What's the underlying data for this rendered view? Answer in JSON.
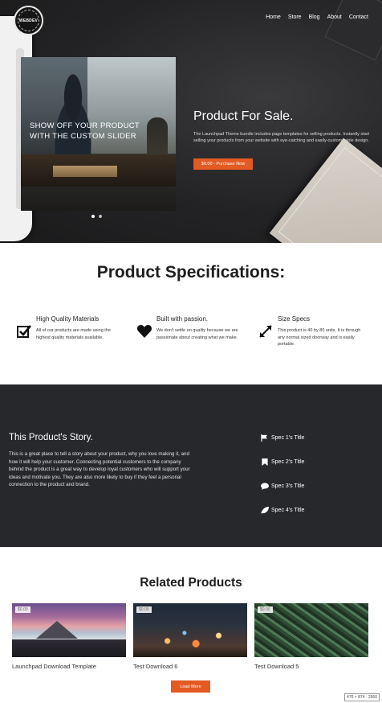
{
  "colors": {
    "accent": "#e35a22",
    "hero_bg": "#232325",
    "story_bg": "#26282c"
  },
  "header": {
    "logo_text": "WEBDEV",
    "nav": [
      "Home",
      "Store",
      "Blog",
      "About",
      "Contact"
    ]
  },
  "hero": {
    "caption": "SHOW OFF YOUR PRODUCT WITH THE CUSTOM SLIDER",
    "title": "Product For Sale.",
    "description": "The Launchpad Theme bundle includes page templates for selling products. Instantly start selling your products from your website with eye-catching and easily-customizable design.",
    "buy_button": "$0.00 - Purchase Now",
    "slides": 2
  },
  "specs": {
    "title": "Product Specifications:",
    "items": [
      {
        "icon": "checkbox-icon",
        "title": "High Quality Materials",
        "text": "All of our products are made using the highest quality materials available."
      },
      {
        "icon": "heart-icon",
        "title": "Built with passion.",
        "text": "We don't settle on quality because we are passionate about creating what we make."
      },
      {
        "icon": "expand-icon",
        "title": "Size Specs",
        "text": "This product is 40 by 80 units. It is through any normal sized doorway and is easily portable."
      }
    ]
  },
  "story": {
    "title": "This Product's Story.",
    "text": "This is a great place to tell a story about your product, why you love making it, and how it will help your customer. Connecting potential customers to the company behind the product is a great way to develop loyal customers who will support your ideas and motivate you. They are also more likely to buy if they feel a personal connection to the product and brand.",
    "spec_list": [
      {
        "icon": "flag-icon",
        "label": "Spec 1's Title"
      },
      {
        "icon": "bookmark-icon",
        "label": "Spec 2's Title"
      },
      {
        "icon": "chat-bubble-icon",
        "label": "Spec 3's Title"
      },
      {
        "icon": "leaf-icon",
        "label": "Spec 4's Title"
      }
    ]
  },
  "related": {
    "title": "Related Products",
    "items": [
      {
        "badge": "$0.00",
        "name": "Launchpad Download Template"
      },
      {
        "badge": "$0.00",
        "name": "Test Download 6"
      },
      {
        "badge": "$0.00",
        "name": "Test Download 5"
      }
    ],
    "load_more": "Load More"
  },
  "footer_dims": "476 × 874 · 2560"
}
